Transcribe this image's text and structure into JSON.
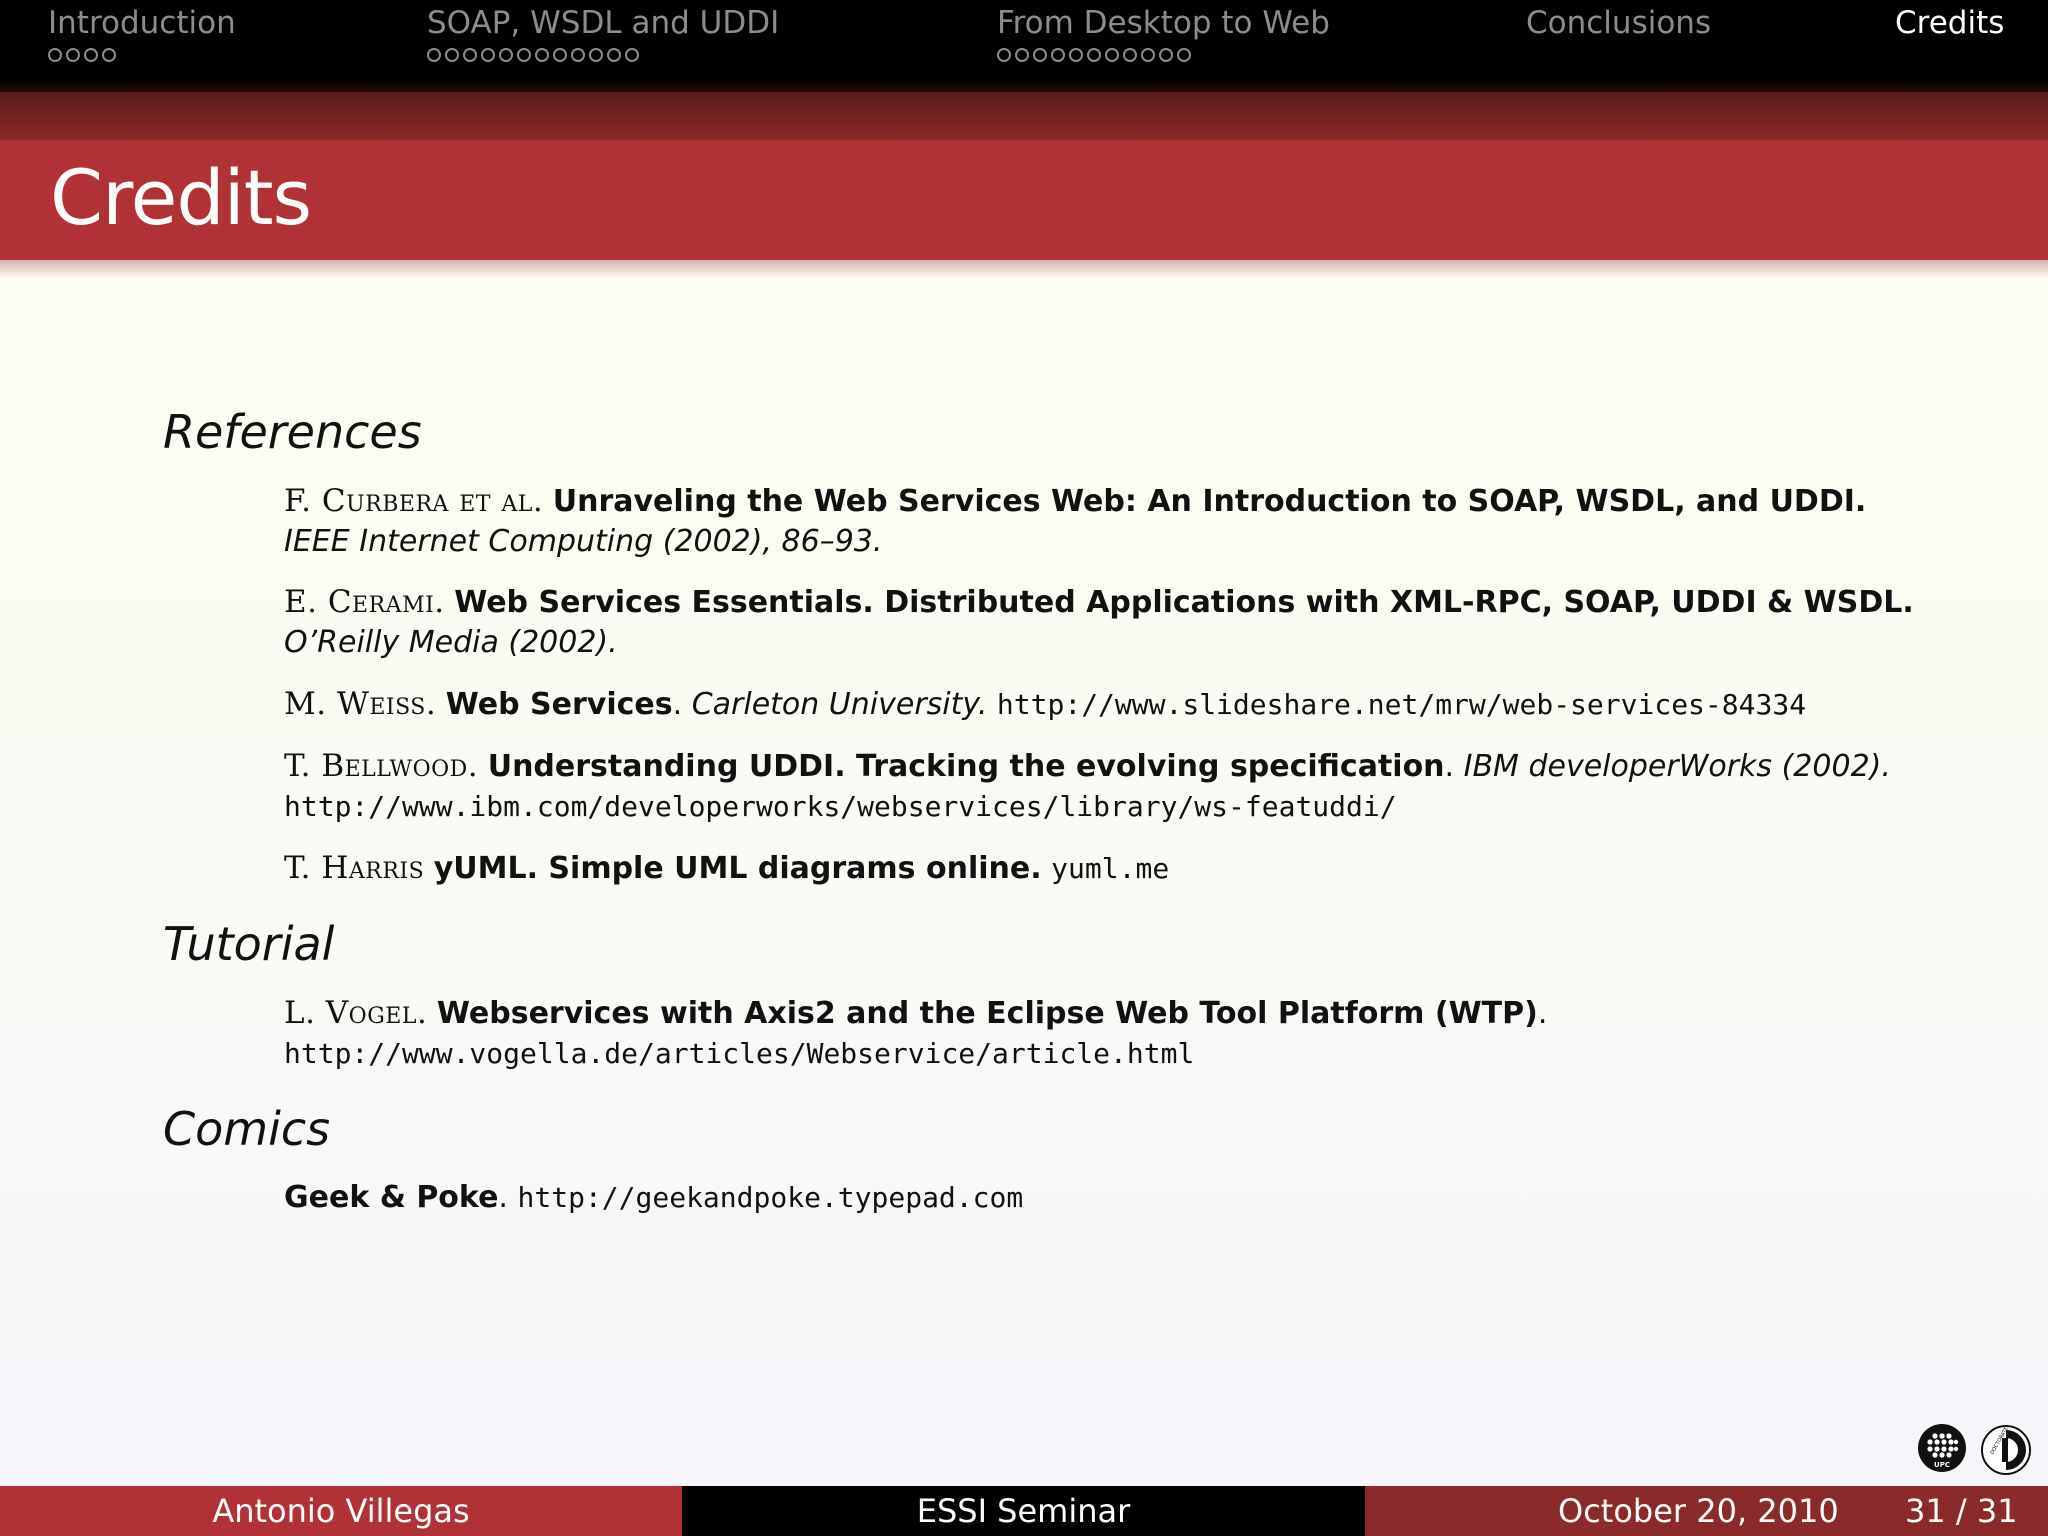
{
  "nav": {
    "sections": [
      {
        "label": "Introduction",
        "dots": 4,
        "active": false
      },
      {
        "label": "SOAP, WSDL and UDDI",
        "dots": 12,
        "active": false
      },
      {
        "label": "From Desktop to Web",
        "dots": 11,
        "active": false
      },
      {
        "label": "Conclusions",
        "dots": 0,
        "active": false
      },
      {
        "label": "Credits",
        "dots": 0,
        "active": true
      }
    ]
  },
  "slide": {
    "title": "Credits"
  },
  "headings": {
    "references": "References",
    "tutorial": "Tutorial",
    "comics": "Comics"
  },
  "references": [
    {
      "author": "F. Curbera et al.",
      "title": "Unraveling the Web Services Web: An Introduction to SOAP, WSDL, and UDDI",
      "venue": "IEEE Internet Computing (2002), 86–93."
    },
    {
      "author": "E. Cerami.",
      "title": "Web Services Essentials. Distributed Applications with XML-RPC, SOAP, UDDI & WSDL",
      "venue": "O’Reilly Media (2002)."
    },
    {
      "author": "M. Weiss.",
      "title": "Web Services",
      "venue": "Carleton University.",
      "url": "http://www.slideshare.net/mrw/web-services-84334"
    },
    {
      "author": "T. Bellwood.",
      "title": "Understanding UDDI. Tracking the evolving specification",
      "venue": "IBM developerWorks (2002).",
      "url": "http://www.ibm.com/developerworks/webservices/library/ws-featuddi/"
    },
    {
      "author": "T. Harris",
      "title": "yUML. Simple UML diagrams online.",
      "url": "yuml.me"
    }
  ],
  "tutorial": {
    "author": "L. Vogel.",
    "title": "Webservices with Axis2 and the Eclipse Web Tool Platform (WTP)",
    "url": "http://www.vogella.de/articles/Webservice/article.html"
  },
  "comics": {
    "title": "Geek & Poke",
    "url": "http://geekandpoke.typepad.com"
  },
  "footer": {
    "author": "Antonio Villegas",
    "event": "ESSI Seminar",
    "date": "October 20, 2010",
    "page": "31 / 31"
  },
  "logos": {
    "upc_text": "UPC",
    "doctorate_text": "DOCTORATE"
  }
}
